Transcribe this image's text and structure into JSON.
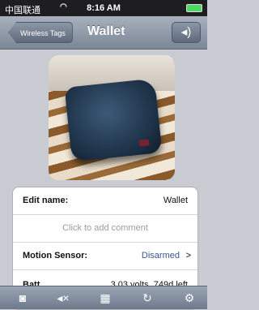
{
  "status_bar": {
    "carrier": "中国联通",
    "wifi_icon": "wifi-icon",
    "time": "8:16 AM"
  },
  "nav": {
    "back_label": "Wireless Tags",
    "title": "Wallet",
    "sound_icon": "speaker-icon"
  },
  "details": {
    "edit_name_label": "Edit name:",
    "edit_name_value": "Wallet",
    "comment_placeholder": "Click to add comment",
    "motion_label": "Motion Sensor:",
    "motion_value": "Disarmed",
    "partial_label": "Batt",
    "partial_value": "3.03 volts, 749d left"
  },
  "toolbar": {
    "items": [
      "camera-icon",
      "mute-icon",
      "calculator-icon",
      "refresh-icon",
      "gear-icon"
    ]
  },
  "colors": {
    "accent": "#385487",
    "nav_top": "#a8b1bd",
    "nav_bottom": "#7b8696"
  }
}
